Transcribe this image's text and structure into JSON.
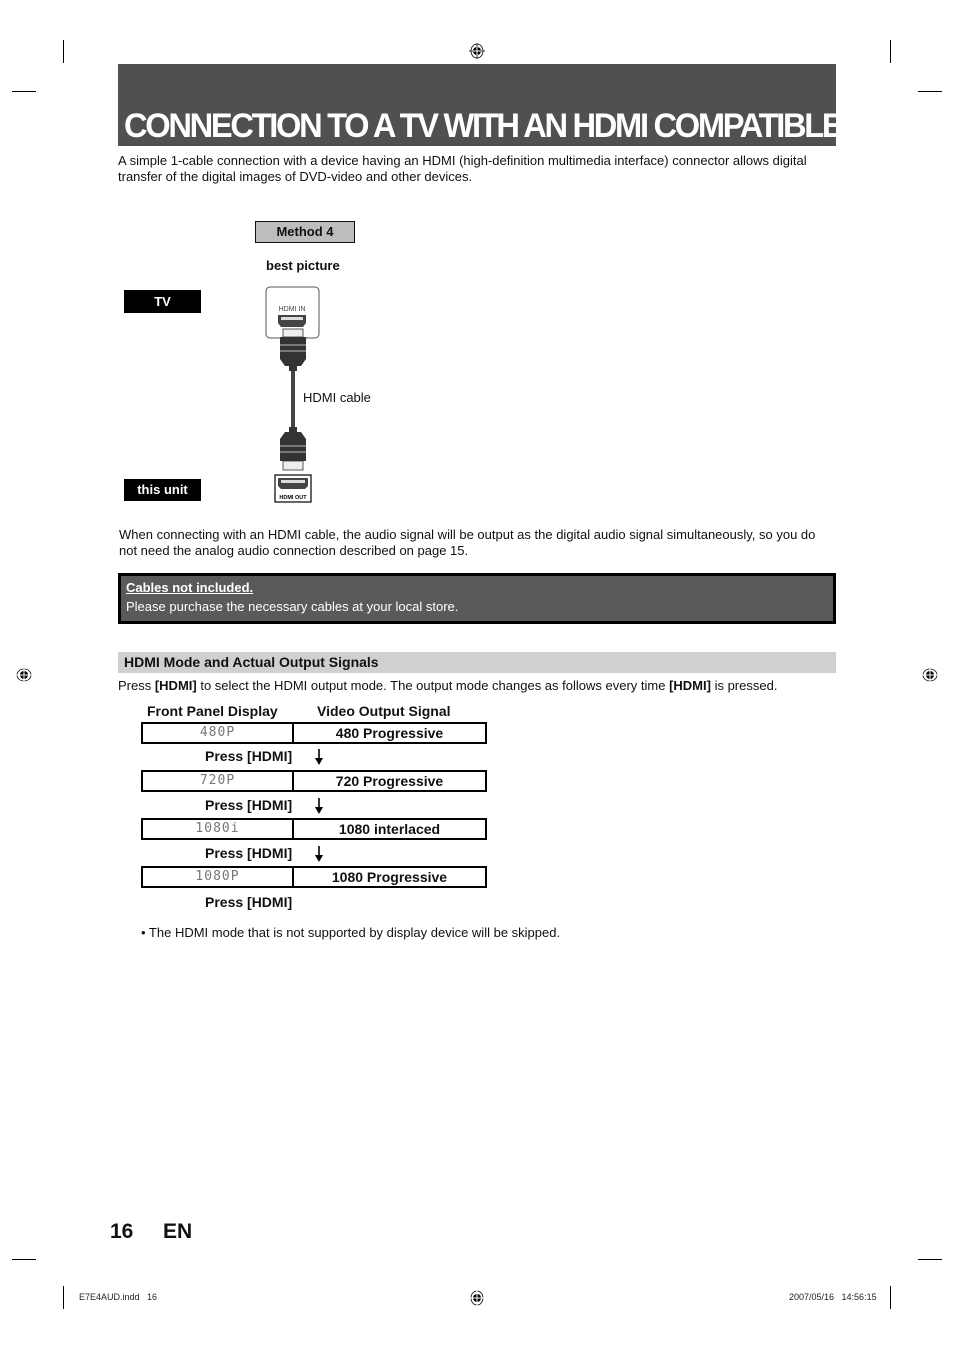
{
  "page": {
    "title": "CONNECTION TO A TV WITH AN HDMI COMPATIBLE PORT",
    "intro": "A simple 1-cable connection with a device having an HDMI (high-definition multimedia interface) connector allows digital transfer of the digital images of DVD-video and other devices.",
    "page_number": "16",
    "language": "EN"
  },
  "diagram": {
    "method_label": "Method 4",
    "quality_label": "best picture",
    "tv_label": "TV",
    "unit_label": "this unit",
    "tv_port_label": "HDMI IN",
    "unit_port_label": "HDMI OUT",
    "cable_label": "HDMI cable"
  },
  "audio_note": "When connecting with an HDMI cable, the audio signal will be output as the digital audio signal simultaneously, so you do not need the analog audio connection described on page 15.",
  "notice": {
    "title": "Cables not included.",
    "body": "Please purchase the necessary cables at your local store."
  },
  "hdmi_mode": {
    "heading": "HDMI Mode and Actual Output Signals",
    "instruction_prefix": "Press ",
    "instruction_key": "[HDMI]",
    "instruction_middle": " to select the HDMI output mode. The output mode changes as follows every time ",
    "instruction_suffix": " is pressed.",
    "col_front_panel": "Front Panel Display",
    "col_video_output": "Video Output Signal",
    "rows": [
      {
        "display": "480P",
        "signal": "480 Progressive"
      },
      {
        "display": "720P",
        "signal": "720 Progressive"
      },
      {
        "display": "1080i",
        "signal": "1080 interlaced"
      },
      {
        "display": "1080P",
        "signal": "1080 Progressive"
      }
    ],
    "press_label": "Press [HDMI]",
    "note": "• The HDMI mode that is not supported by display device will be skipped."
  },
  "slug": {
    "file": "E7E4AUD.indd   16",
    "timestamp": "2007/05/16   14:56:15"
  }
}
